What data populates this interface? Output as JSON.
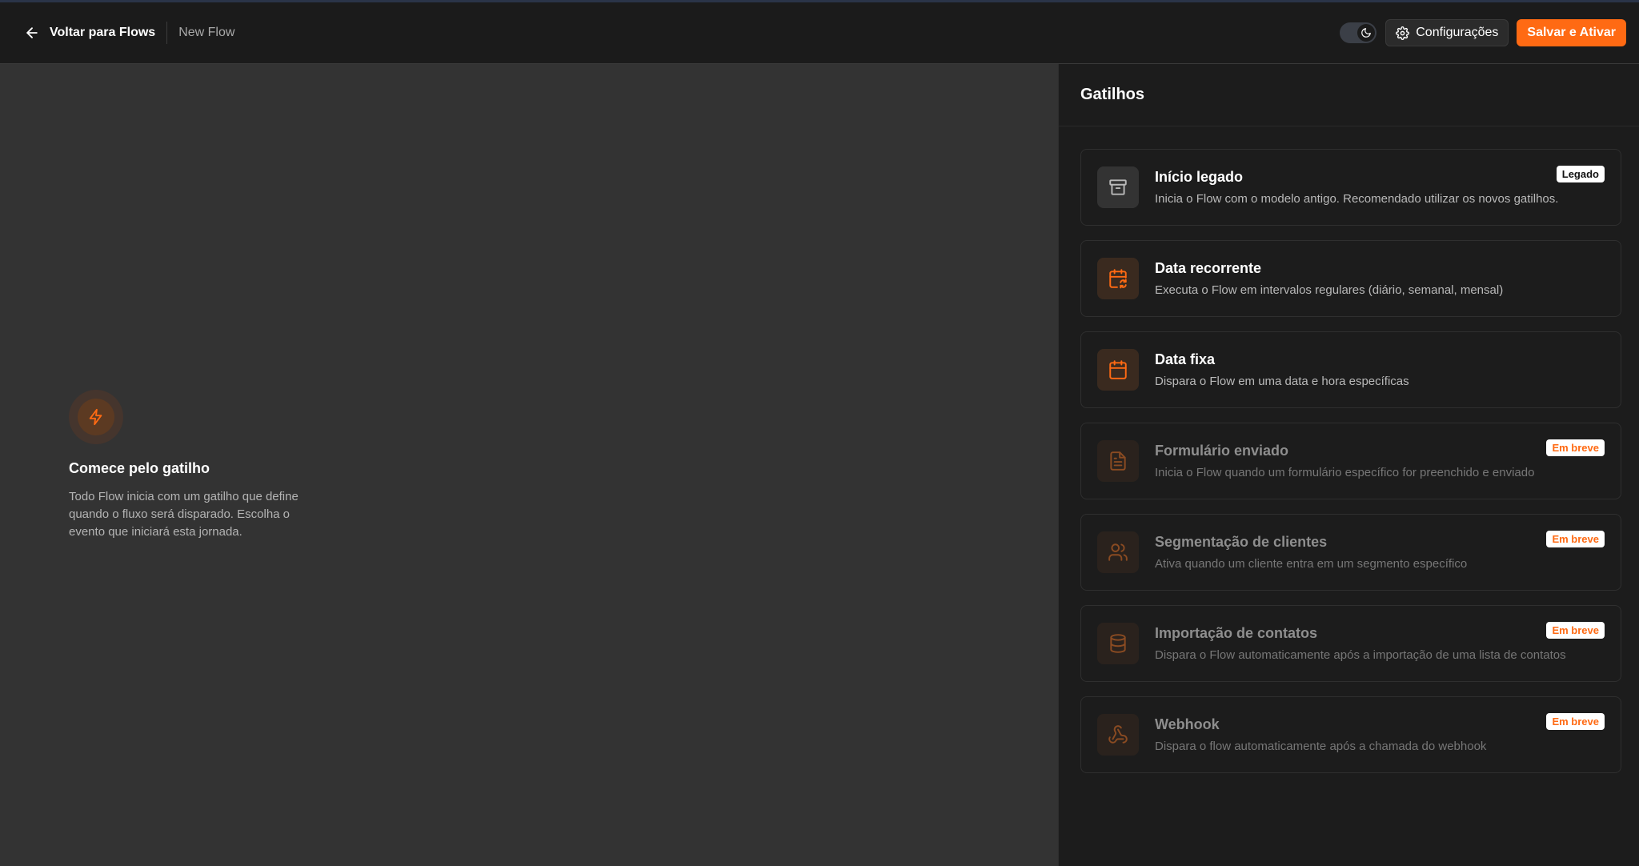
{
  "header": {
    "back_label": "Voltar para Flows",
    "flow_name": "New Flow",
    "settings_label": "Configurações",
    "save_label": "Salvar e Ativar"
  },
  "colors": {
    "accent": "#ff6a13",
    "background": "#333333",
    "panel": "#1c1c1c"
  },
  "canvas": {
    "empty_title": "Comece pelo gatilho",
    "empty_description": "Todo Flow inicia com um gatilho que define quando o fluxo será disparado. Escolha o evento que iniciará esta jornada.",
    "icon": "bolt-icon"
  },
  "panel": {
    "title": "Gatilhos",
    "triggers": [
      {
        "title": "Início legado",
        "description": "Inicia o Flow com o modelo antigo. Recomendado utilizar os novos gatilhos.",
        "badge": "Legado",
        "icon": "archive-icon",
        "enabled": true
      },
      {
        "title": "Data recorrente",
        "description": "Executa o Flow em intervalos regulares (diário, semanal, mensal)",
        "badge": "",
        "icon": "calendar-repeat-icon",
        "enabled": true
      },
      {
        "title": "Data fixa",
        "description": "Dispara o Flow em uma data e hora específicas",
        "badge": "",
        "icon": "calendar-icon",
        "enabled": true
      },
      {
        "title": "Formulário enviado",
        "description": "Inicia o Flow quando um formulário específico for preenchido e enviado",
        "badge": "Em breve",
        "icon": "document-icon",
        "enabled": false
      },
      {
        "title": "Segmentação de clientes",
        "description": "Ativa quando um cliente entra em um segmento específico",
        "badge": "Em breve",
        "icon": "users-icon",
        "enabled": false
      },
      {
        "title": "Importação de contatos",
        "description": "Dispara o Flow automaticamente após a importação de uma lista de contatos",
        "badge": "Em breve",
        "icon": "database-icon",
        "enabled": false
      },
      {
        "title": "Webhook",
        "description": "Dispara o flow automaticamente após a chamada do webhook",
        "badge": "Em breve",
        "icon": "webhook-icon",
        "enabled": false
      }
    ]
  }
}
